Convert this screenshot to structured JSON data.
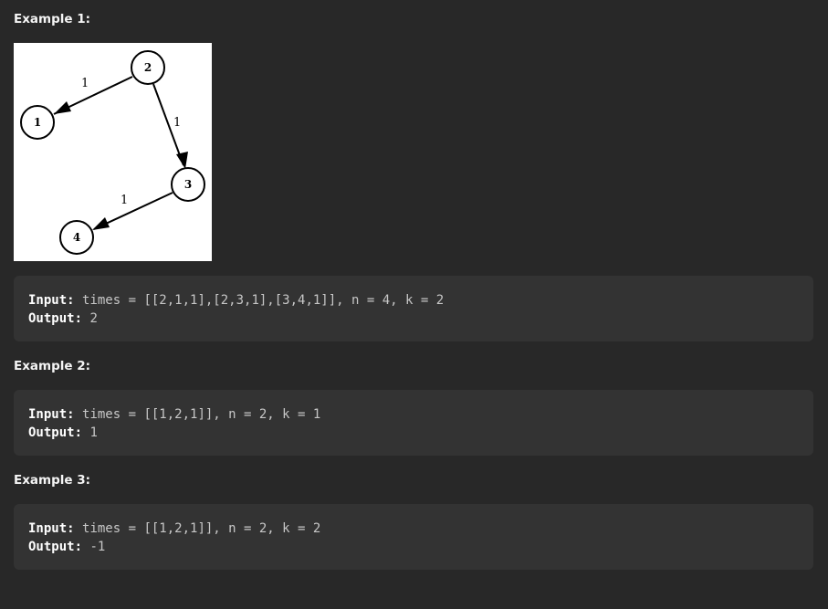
{
  "examples": [
    {
      "heading": "Example 1:",
      "input_label": "Input:",
      "input_value": "times = [[2,1,1],[2,3,1],[3,4,1]], n = 4, k = 2",
      "output_label": "Output:",
      "output_value": "2",
      "graph": {
        "nodes": [
          "2",
          "1",
          "3",
          "4"
        ],
        "edges": [
          {
            "from": "2",
            "to": "1",
            "weight": "1"
          },
          {
            "from": "2",
            "to": "3",
            "weight": "1"
          },
          {
            "from": "3",
            "to": "4",
            "weight": "1"
          }
        ]
      }
    },
    {
      "heading": "Example 2:",
      "input_label": "Input:",
      "input_value": "times = [[1,2,1]], n = 2, k = 1",
      "output_label": "Output:",
      "output_value": "1"
    },
    {
      "heading": "Example 3:",
      "input_label": "Input:",
      "input_value": "times = [[1,2,1]], n = 2, k = 2",
      "output_label": "Output:",
      "output_value": "-1"
    }
  ],
  "colors": {
    "background": "#282828",
    "code_background": "#333333",
    "label": "#ffffff",
    "value": "#c7c7c7"
  }
}
